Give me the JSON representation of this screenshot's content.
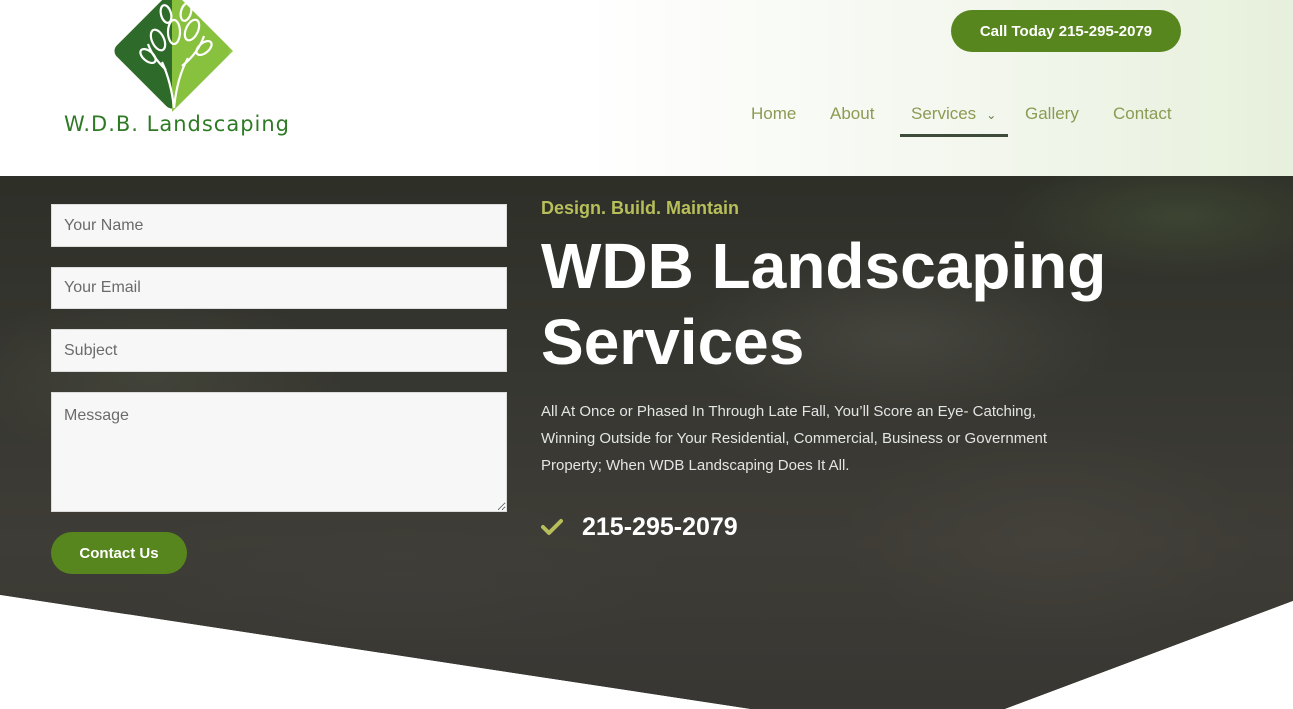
{
  "brand": {
    "name": "W.D.B. Landscaping",
    "colors": {
      "primary_green": "#58861e",
      "nav_text": "#8c9a52",
      "tagline": "#b7be5a",
      "logo_dark": "#2e6b2a",
      "logo_light": "#8cc63f"
    }
  },
  "header": {
    "call_button": "Call Today 215-295-2079",
    "nav": [
      {
        "label": "Home"
      },
      {
        "label": "About"
      },
      {
        "label": "Services",
        "active": true,
        "has_dropdown": true
      },
      {
        "label": "Gallery"
      },
      {
        "label": "Contact"
      }
    ]
  },
  "form": {
    "name_placeholder": "Your Name",
    "email_placeholder": "Your Email",
    "subject_placeholder": "Subject",
    "message_placeholder": "Message",
    "submit_label": "Contact Us"
  },
  "hero": {
    "tagline": "Design. Build. Maintain",
    "headline": "WDB Landscaping Services",
    "description": "All At Once or Phased In Through Late Fall, You’ll Score an Eye- Catching, Winning Outside for Your Residential, Commercial, Business or Government Property; When WDB Landscaping Does It All.",
    "phone": "215-295-2079",
    "check_icon": "check-icon"
  }
}
